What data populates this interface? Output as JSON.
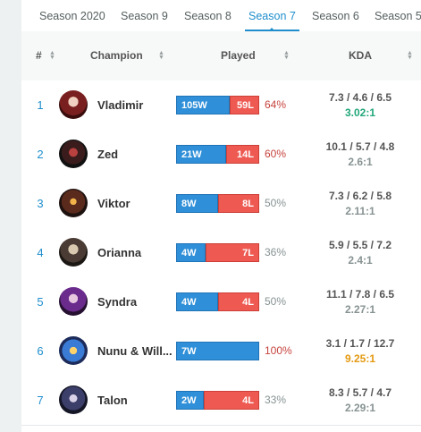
{
  "tabs": [
    {
      "label": "Season 2020",
      "active": false
    },
    {
      "label": "Season 9",
      "active": false
    },
    {
      "label": "Season 8",
      "active": false
    },
    {
      "label": "Season 7",
      "active": true
    },
    {
      "label": "Season 6",
      "active": false
    },
    {
      "label": "Season 5",
      "active": false
    }
  ],
  "headers": {
    "rank": "#",
    "champion": "Champion",
    "played": "Played",
    "kda": "KDA"
  },
  "colors": {
    "accent": "#1f8ecd",
    "win": "#2f8fd8",
    "loss": "#ee5a52",
    "wr_high": "#c6443e",
    "wr_low": "#879292",
    "kda_green": "#22a77a",
    "kda_gold": "#e49a12",
    "kda_gray": "#879292"
  },
  "rows": [
    {
      "rank": "1",
      "name": "Vladimir",
      "icon": "vladimir-portrait",
      "wins": "105W",
      "losses": "59L",
      "win_fraction": 0.64,
      "winrate": "64%",
      "kda": "7.3 / 4.6 / 6.5",
      "ratio": "3.02:1",
      "ratio_color": "#22a77a",
      "wr_color": "#c6443e"
    },
    {
      "rank": "2",
      "name": "Zed",
      "icon": "zed-portrait",
      "wins": "21W",
      "losses": "14L",
      "win_fraction": 0.6,
      "winrate": "60%",
      "kda": "10.1 / 5.7 / 4.8",
      "ratio": "2.6:1",
      "ratio_color": "#879292",
      "wr_color": "#c6443e"
    },
    {
      "rank": "3",
      "name": "Viktor",
      "icon": "viktor-portrait",
      "wins": "8W",
      "losses": "8L",
      "win_fraction": 0.5,
      "winrate": "50%",
      "kda": "7.3 / 6.2 / 5.8",
      "ratio": "2.11:1",
      "ratio_color": "#879292",
      "wr_color": "#879292"
    },
    {
      "rank": "4",
      "name": "Orianna",
      "icon": "orianna-portrait",
      "wins": "4W",
      "losses": "7L",
      "win_fraction": 0.36,
      "winrate": "36%",
      "kda": "5.9 / 5.5 / 7.2",
      "ratio": "2.4:1",
      "ratio_color": "#879292",
      "wr_color": "#879292"
    },
    {
      "rank": "5",
      "name": "Syndra",
      "icon": "syndra-portrait",
      "wins": "4W",
      "losses": "4L",
      "win_fraction": 0.5,
      "winrate": "50%",
      "kda": "11.1 / 7.8 / 6.5",
      "ratio": "2.27:1",
      "ratio_color": "#879292",
      "wr_color": "#879292"
    },
    {
      "rank": "6",
      "name": "Nunu & Will...",
      "icon": "nunu-portrait",
      "wins": "7W",
      "losses": "",
      "win_fraction": 1.0,
      "winrate": "100%",
      "kda": "3.1 / 1.7 / 12.7",
      "ratio": "9.25:1",
      "ratio_color": "#e49a12",
      "wr_color": "#c6443e"
    },
    {
      "rank": "7",
      "name": "Talon",
      "icon": "talon-portrait",
      "wins": "2W",
      "losses": "4L",
      "win_fraction": 0.33,
      "winrate": "33%",
      "kda": "8.3 / 5.7 / 4.7",
      "ratio": "2.29:1",
      "ratio_color": "#879292",
      "wr_color": "#879292"
    }
  ]
}
